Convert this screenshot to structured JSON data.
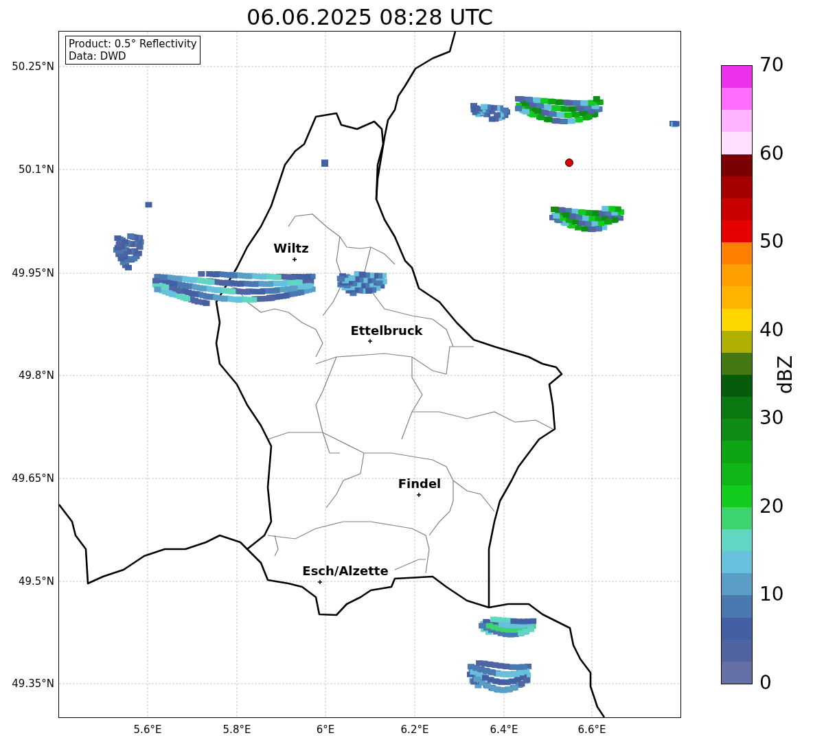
{
  "title": "06.06.2025 08:28 UTC",
  "info_box": [
    "Product: 0.5° Reflectivity",
    "Data: DWD"
  ],
  "map": {
    "x_ticks": [
      "5.6°E",
      "5.8°E",
      "6°E",
      "6.2°E",
      "6.4°E",
      "6.6°E"
    ],
    "y_ticks": [
      "50.25°N",
      "50.1°N",
      "49.95°N",
      "49.8°N",
      "49.65°N",
      "49.5°N",
      "49.35°N"
    ],
    "places": [
      {
        "name": "Wiltz"
      },
      {
        "name": "Ettelbruck"
      },
      {
        "name": "Findel"
      },
      {
        "name": "Esch/Alzette"
      }
    ]
  },
  "colorbar": {
    "label": "dBZ",
    "ticks": [
      "70",
      "60",
      "50",
      "40",
      "30",
      "20",
      "10",
      "0"
    ],
    "bands": [
      {
        "color": "#6470a6"
      },
      {
        "color": "#4f64a0"
      },
      {
        "color": "#4460a5"
      },
      {
        "color": "#4a78b0"
      },
      {
        "color": "#5a9ec6"
      },
      {
        "color": "#67c0dc"
      },
      {
        "color": "#62d6c4"
      },
      {
        "color": "#3dd36e"
      },
      {
        "color": "#12cb1c"
      },
      {
        "color": "#10b518"
      },
      {
        "color": "#0ea514"
      },
      {
        "color": "#0e8c14"
      },
      {
        "color": "#0b7812"
      },
      {
        "color": "#075c0b"
      },
      {
        "color": "#447810"
      },
      {
        "color": "#b0b000"
      },
      {
        "color": "#ffd700"
      },
      {
        "color": "#ffb400"
      },
      {
        "color": "#ffa000"
      },
      {
        "color": "#ff8000"
      },
      {
        "color": "#e60000"
      },
      {
        "color": "#c80000"
      },
      {
        "color": "#a50000"
      },
      {
        "color": "#780000"
      },
      {
        "color": "#ffe0ff"
      },
      {
        "color": "#ffb4ff"
      },
      {
        "color": "#ff6eff"
      },
      {
        "color": "#ec32ec"
      }
    ]
  }
}
